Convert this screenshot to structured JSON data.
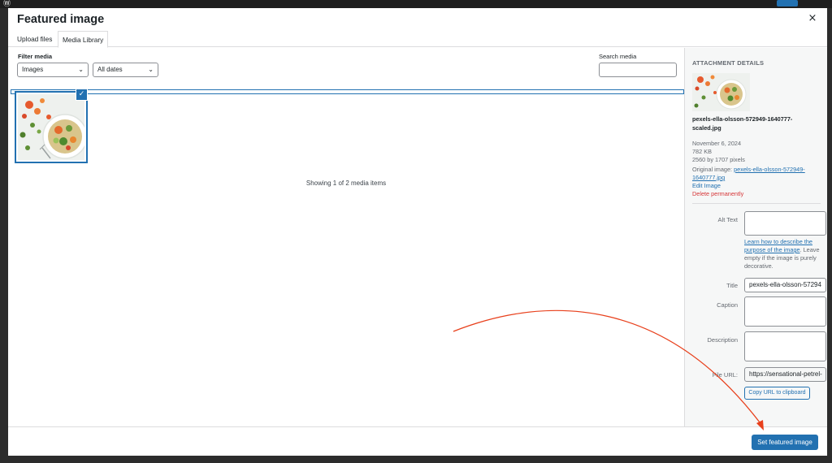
{
  "modal": {
    "title": "Featured image",
    "close_glyph": "×"
  },
  "tabs": [
    {
      "label": "Upload files",
      "active": false
    },
    {
      "label": "Media Library",
      "active": true
    }
  ],
  "filters": {
    "label": "Filter media",
    "type_value": "Images",
    "date_value": "All dates",
    "chevron": "⌄"
  },
  "search": {
    "label": "Search media",
    "value": ""
  },
  "grid": {
    "selected_check": "✓",
    "showing_text": "Showing 1 of 2 media items"
  },
  "details": {
    "heading": "ATTACHMENT DETAILS",
    "filename": "pexels-ella-olsson-572949-1640777-scaled.jpg",
    "date": "November 6, 2024",
    "size": "782 KB",
    "dimensions": "2560 by 1707 pixels",
    "original_label": "Original image:",
    "original_link": "pexels-ella-olsson-572949-1640777.jpg",
    "edit_link": "Edit Image",
    "delete_link": "Delete permanently"
  },
  "fields": {
    "alt_label": "Alt Text",
    "alt_value": "",
    "alt_help_link": "Learn how to describe the purpose of the image",
    "alt_help_text": ". Leave empty if the image is purely decorative.",
    "title_label": "Title",
    "title_value": "pexels-ella-olsson-57294",
    "caption_label": "Caption",
    "caption_value": "",
    "description_label": "Description",
    "description_value": "",
    "url_label": "File URL:",
    "url_value": "https://sensational-petrel-",
    "copy_label": "Copy URL to clipboard"
  },
  "footer": {
    "set_button": "Set featured image"
  },
  "colors": {
    "accent": "#2271b1",
    "danger": "#d63638",
    "annotation": "#e8401c"
  }
}
